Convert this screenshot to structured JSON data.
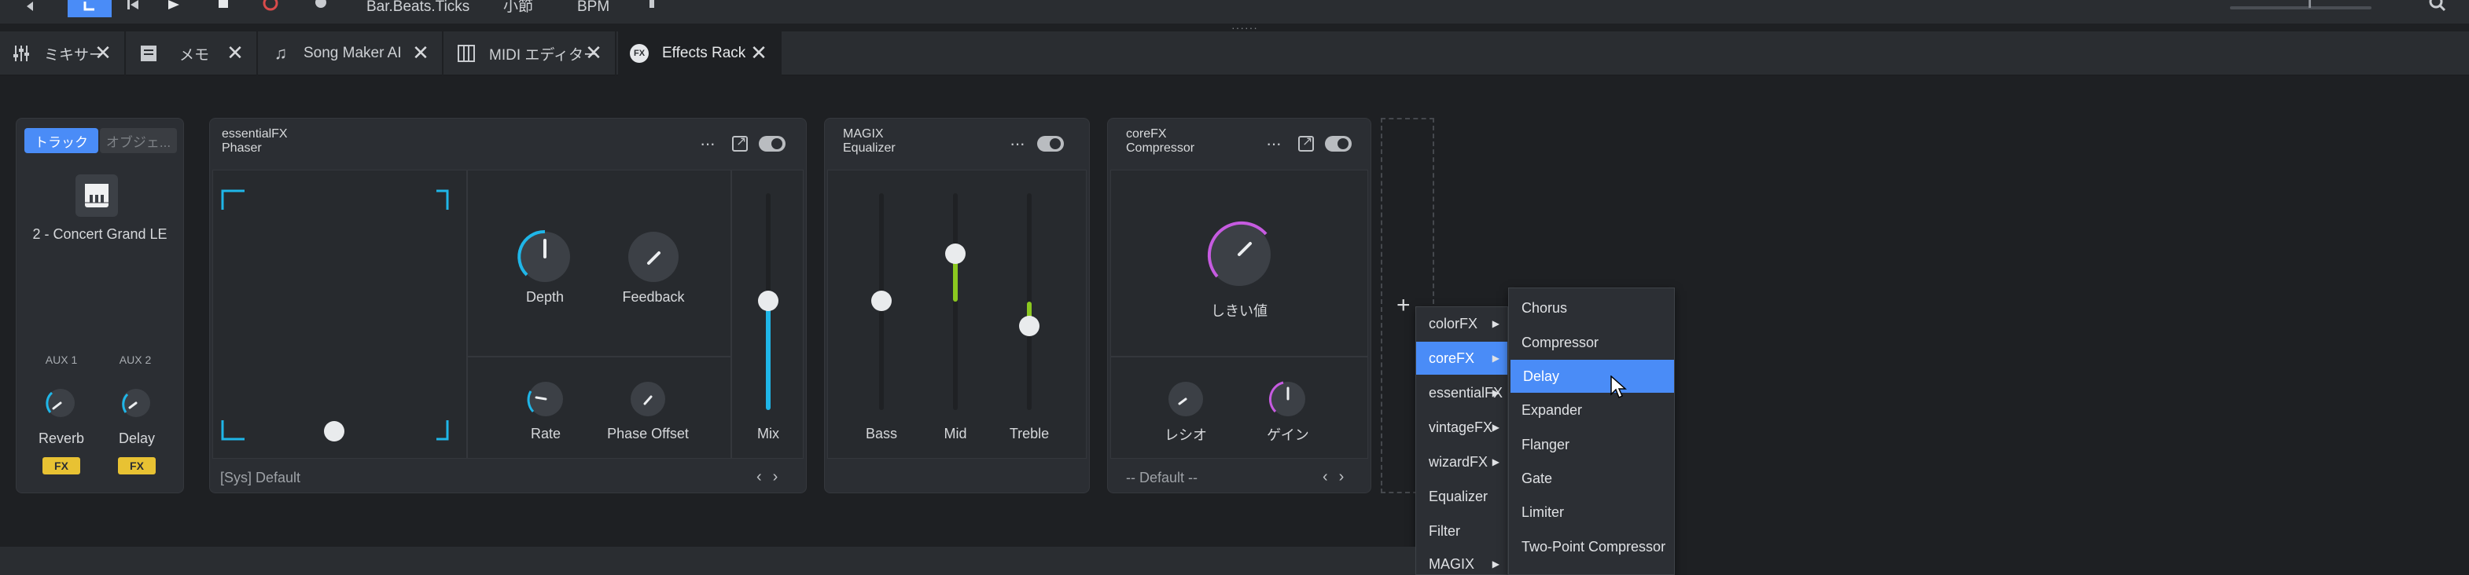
{
  "transport": {
    "time_format": "Bar.Beats.Ticks",
    "bar_label": "小節",
    "bpm_label": "BPM"
  },
  "tabs": [
    {
      "label": "ミキサー",
      "icon": "mixer-icon"
    },
    {
      "label": "メモ",
      "icon": "memo-icon"
    },
    {
      "label": "Song Maker AI",
      "icon": "music-note-icon"
    },
    {
      "label": "MIDI エディター",
      "icon": "piano-roll-icon"
    },
    {
      "label": "Effects Rack",
      "icon": "fx-icon"
    }
  ],
  "track_panel": {
    "seg_track": "トラック",
    "seg_object": "オブジェ...",
    "instrument": "2 - Concert Grand LE",
    "aux1_label": "AUX 1",
    "aux2_label": "AUX 2",
    "aux1_name": "Reverb",
    "aux2_name": "Delay",
    "fx_badge": "FX"
  },
  "phaser": {
    "vendor": "essentialFX",
    "name": "Phaser",
    "depth_label": "Depth",
    "feedback_label": "Feedback",
    "rate_label": "Rate",
    "phase_offset_label": "Phase Offset",
    "mix_label": "Mix",
    "preset": "[Sys] Default"
  },
  "equalizer": {
    "vendor": "MAGIX",
    "name": "Equalizer",
    "bass_label": "Bass",
    "mid_label": "Mid",
    "treble_label": "Treble"
  },
  "compressor": {
    "vendor": "coreFX",
    "name": "Compressor",
    "threshold_label": "しきい値",
    "ratio_label": "レシオ",
    "gain_label": "ゲイン",
    "preset": "-- Default --"
  },
  "category_menu": [
    {
      "label": "colorFX",
      "submenu": true
    },
    {
      "label": "coreFX",
      "submenu": true,
      "highlighted": true
    },
    {
      "label": "essentialFX",
      "submenu": true
    },
    {
      "label": "vintageFX",
      "submenu": true
    },
    {
      "label": "wizardFX",
      "submenu": true
    },
    {
      "label": "Equalizer",
      "submenu": false
    },
    {
      "label": "Filter",
      "submenu": false
    },
    {
      "label": "MAGIX",
      "submenu": true
    }
  ],
  "corefx_menu": [
    {
      "label": "Chorus"
    },
    {
      "label": "Compressor"
    },
    {
      "label": "Delay",
      "highlighted": true
    },
    {
      "label": "Expander"
    },
    {
      "label": "Flanger"
    },
    {
      "label": "Gate"
    },
    {
      "label": "Limiter"
    },
    {
      "label": "Two-Point Compressor"
    }
  ],
  "colors": {
    "accent": "#4a8cf7",
    "knob_ring_cyan": "#1fb6e8",
    "knob_ring_magenta": "#c65be0",
    "eq_green": "#8bc820",
    "fx_badge": "#e8c233"
  }
}
